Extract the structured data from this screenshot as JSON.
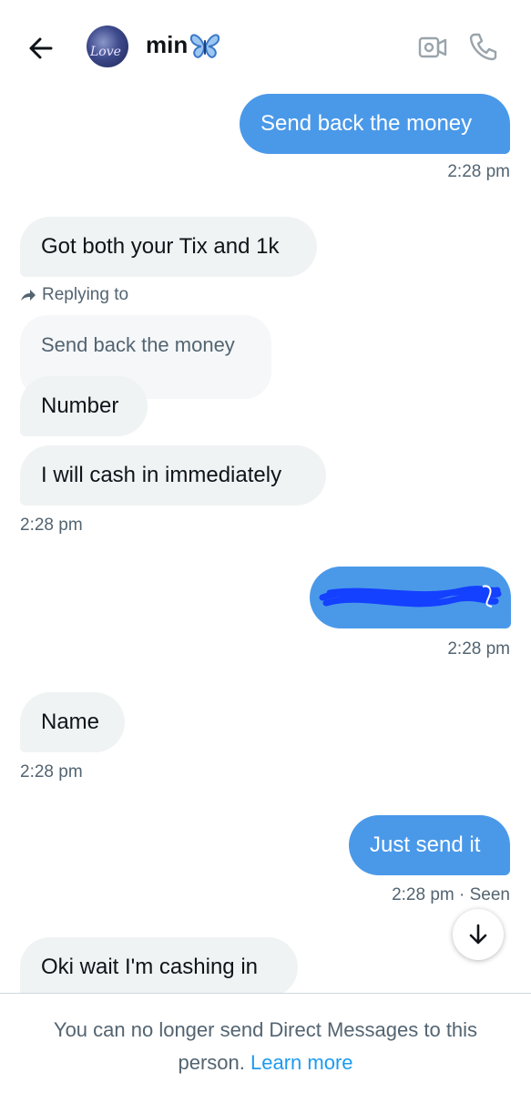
{
  "header": {
    "contact_name": "min",
    "avatar_text": "Love",
    "icons": {
      "back": "arrow-left-icon",
      "emoji": "butterfly-icon",
      "video": "video-call-icon",
      "call": "phone-icon"
    }
  },
  "messages": {
    "m1": {
      "text": "Send back the money",
      "time": "2:28 pm"
    },
    "m2": {
      "text": "Got both your Tix and 1k"
    },
    "reply": {
      "label": "Replying to",
      "quoted": "Send back the money"
    },
    "m3": {
      "text": "Number"
    },
    "m4": {
      "text": "I will cash in immediately",
      "time": "2:28 pm"
    },
    "m5": {
      "time": "2:28 pm"
    },
    "m6": {
      "text": "Name",
      "time": "2:28 pm"
    },
    "m7": {
      "text": "Just send it",
      "time": "2:28 pm · Seen"
    },
    "m8": {
      "text": "Oki wait I'm cashing in"
    }
  },
  "footer": {
    "notice": "You can no longer send Direct Messages to this person.",
    "link": "Learn more"
  },
  "colors": {
    "sent_bubble": "#4a99e9",
    "received_bubble": "#eff3f4",
    "link": "#1d9bf0",
    "timestamp": "#536471"
  }
}
